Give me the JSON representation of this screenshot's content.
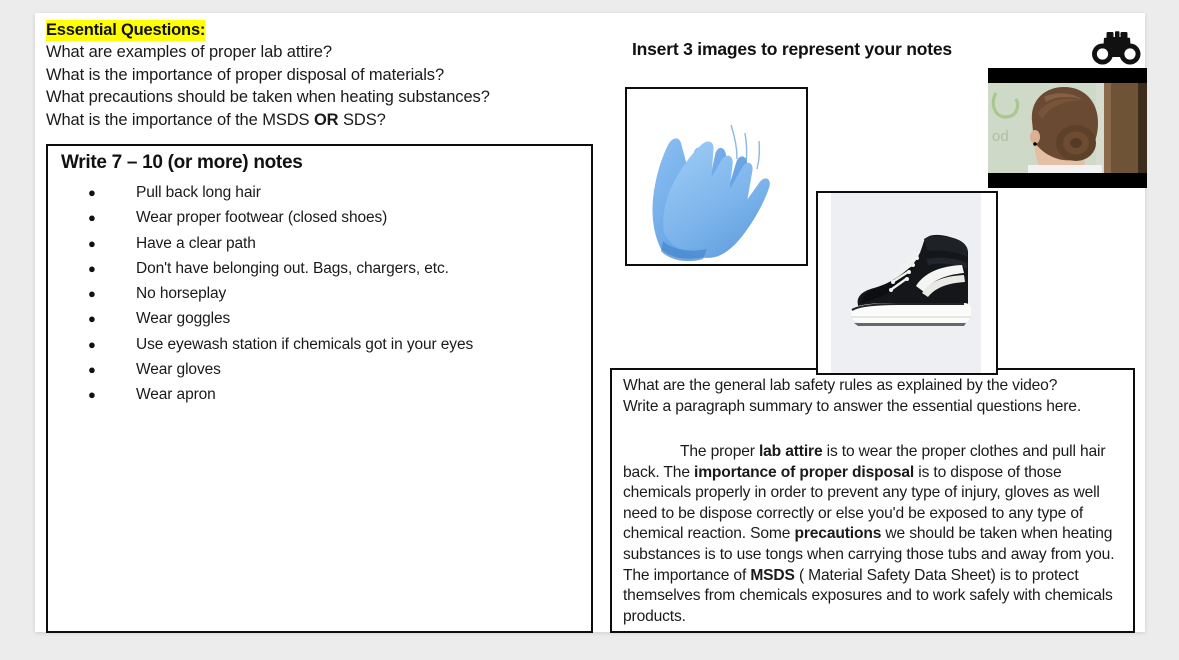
{
  "slide": {
    "essential_questions": {
      "heading": "Essential Questions:",
      "questions": [
        "What are examples of proper lab attire?",
        "What is the importance of proper disposal of materials?",
        "What precautions should be taken when heating substances?"
      ],
      "last_question_pre": "What is the importance of the MSDS ",
      "last_question_bold": "OR",
      "last_question_post": " SDS?"
    },
    "notes_box": {
      "title": "Write 7 – 10 (or more) notes",
      "bullet_glyph": "●",
      "items": [
        "Pull back long hair",
        "Wear proper footwear (closed shoes)",
        "Have a clear path",
        "Don't have belonging out. Bags, chargers, etc.",
        "No horseplay",
        "Wear goggles",
        "Use eyewash station if chemicals got in your eyes",
        "Wear gloves",
        "Wear apron"
      ]
    },
    "images_section": {
      "heading": "Insert 3 images to represent your notes",
      "binoculars_icon": "binoculars-icon",
      "image_gloves": "blue-nitrile-gloves-photo",
      "image_shoe": "black-high-top-sneaker-photo",
      "image_video": "video-thumbnail-hair-in-bun"
    },
    "paragraph_box": {
      "prompt_line_1": "What are the general lab safety rules as explained by the video?",
      "prompt_line_2": "Write a paragraph summary to answer the essential questions here.",
      "answer_parts": [
        {
          "text": "The proper ",
          "bold": false
        },
        {
          "text": "lab attire",
          "bold": true
        },
        {
          "text": " is to wear the proper clothes and pull hair back.  The ",
          "bold": false
        },
        {
          "text": "importance of proper disposal",
          "bold": true
        },
        {
          "text": " is to dispose of those chemicals properly in order to prevent any type of injury, gloves as well need to be dispose correctly or else you'd be exposed to any type of chemical reaction. Some ",
          "bold": false
        },
        {
          "text": "precautions",
          "bold": true
        },
        {
          "text": " we should be taken when heating substances is to use tongs when carrying those tubs and away from you. The importance of ",
          "bold": false
        },
        {
          "text": "MSDS",
          "bold": true
        },
        {
          "text": " ( Material Safety Data Sheet) is to protect themselves from chemicals exposures and to work safely with chemicals products.",
          "bold": false
        }
      ]
    },
    "colors": {
      "highlight": "#ffff00",
      "border": "#0d0d0d",
      "text": "#1a1a1a",
      "page_background": "#ececec",
      "slide_background": "#ffffff",
      "glove_blue": "#6ba7e6",
      "shoe_black": "#14161a",
      "shoe_backdrop": "#edeff3"
    }
  }
}
